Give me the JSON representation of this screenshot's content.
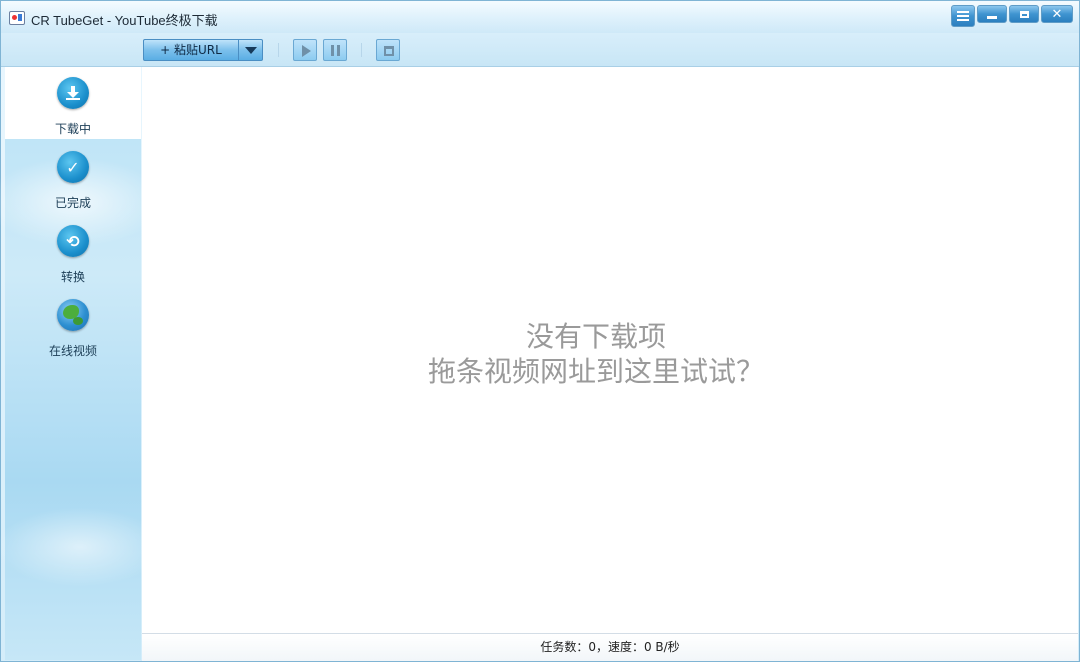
{
  "window": {
    "title": "CR TubeGet - YouTube终极下载"
  },
  "toolbar": {
    "paste_url_label": "+ 粘贴URL"
  },
  "sidebar": {
    "items": [
      {
        "label": "下载中",
        "icon": "download-icon",
        "active": true
      },
      {
        "label": "已完成",
        "icon": "check-icon",
        "active": false
      },
      {
        "label": "转换",
        "icon": "convert-icon",
        "active": false
      },
      {
        "label": "在线视频",
        "icon": "globe-icon",
        "active": false
      }
    ]
  },
  "main": {
    "empty_title": "没有下载项",
    "empty_hint": "拖条视频网址到这里试试？"
  },
  "status": {
    "text": "任务数：0，速度：0 B/秒"
  },
  "colors": {
    "accent": "#1b8fcc",
    "sidebar_bg": "#b9e2f6",
    "empty_text": "#9a9a9a"
  }
}
